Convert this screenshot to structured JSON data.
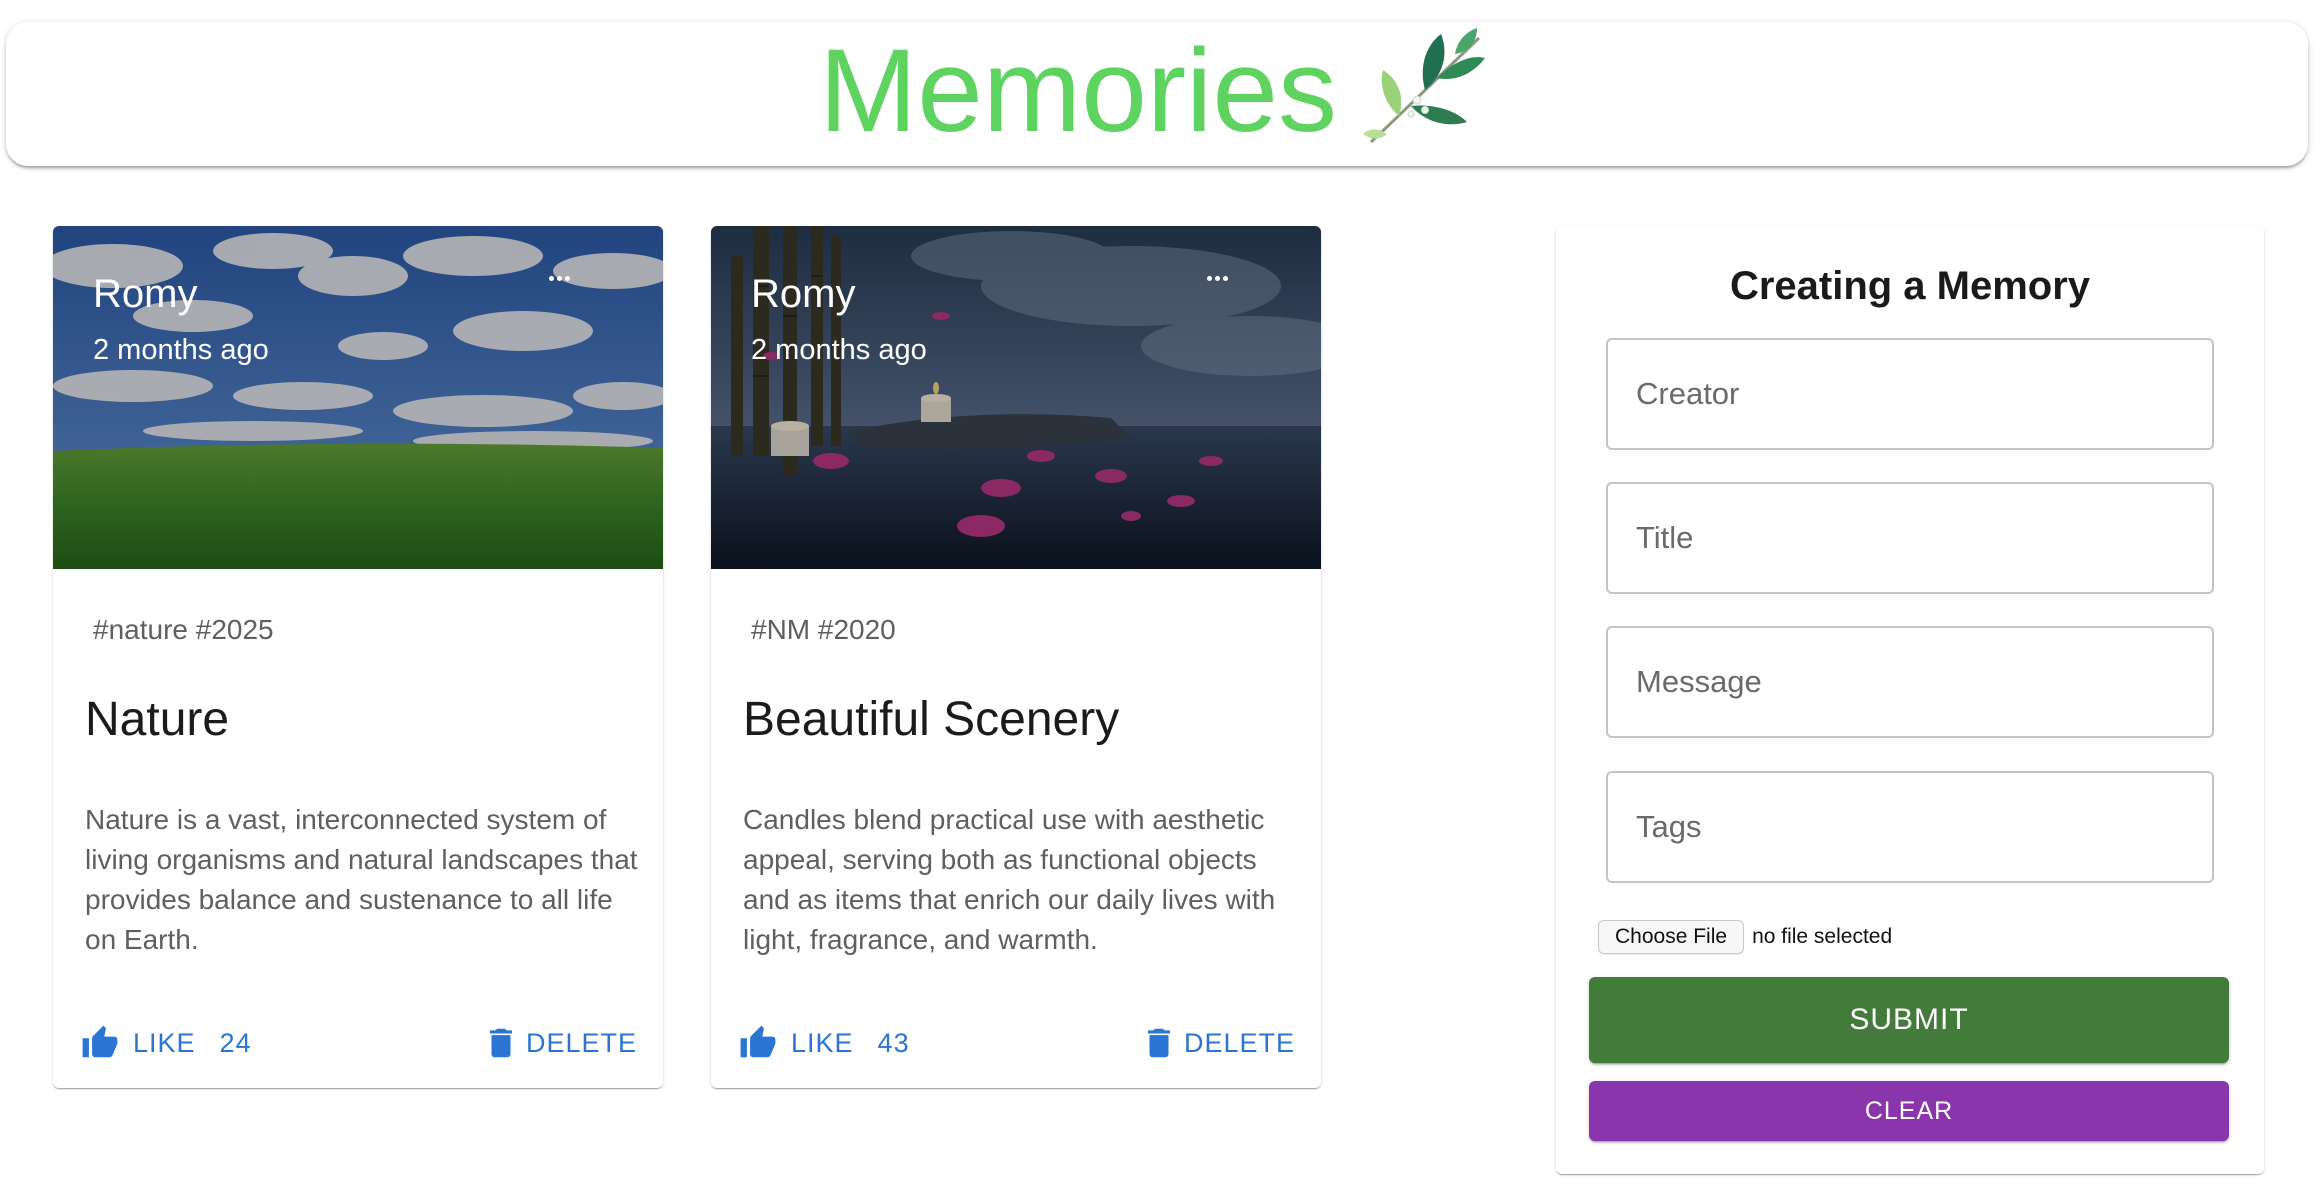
{
  "app": {
    "title": "Memories",
    "logo_icon": "leaf-branch-icon",
    "title_color": "#5fd35f"
  },
  "posts": [
    {
      "creator": "Romy",
      "time": "2 months ago",
      "image_icon": "green-field-sky-image",
      "more_icon": "more-horizontal-icon",
      "tags": "#nature #2025",
      "title": "Nature",
      "message": "Nature is a vast, interconnected system of living organisms and natural landscapes that provides balance and sustenance to all life on Earth.",
      "like_label": "LIKE",
      "like_icon": "thumb-up-icon",
      "like_count": "24",
      "delete_label": "DELETE",
      "delete_icon": "trash-icon"
    },
    {
      "creator": "Romy",
      "time": "2 months ago",
      "image_icon": "candles-bamboo-water-image",
      "more_icon": "more-horizontal-icon",
      "tags": "#NM #2020",
      "title": "Beautiful Scenery",
      "message": "Candles blend practical use with aesthetic appeal, serving both as functional objects and as items that enrich our daily lives with light, fragrance, and warmth.",
      "like_label": "LIKE",
      "like_icon": "thumb-up-icon",
      "like_count": "43",
      "delete_label": "DELETE",
      "delete_icon": "trash-icon"
    }
  ],
  "form": {
    "heading": "Creating a Memory",
    "creator_placeholder": "Creator",
    "title_placeholder": "Title",
    "message_placeholder": "Message",
    "tags_placeholder": "Tags",
    "creator_value": "",
    "title_value": "",
    "message_value": "",
    "tags_value": "",
    "file_button_label": "Choose File",
    "file_status": "no file selected",
    "submit_label": "SUBMIT",
    "clear_label": "CLEAR",
    "submit_color": "#437b3a",
    "clear_color": "#8a35ab"
  },
  "colors": {
    "accent_blue": "#2a75d3",
    "text_secondary": "#5f5f5f"
  }
}
